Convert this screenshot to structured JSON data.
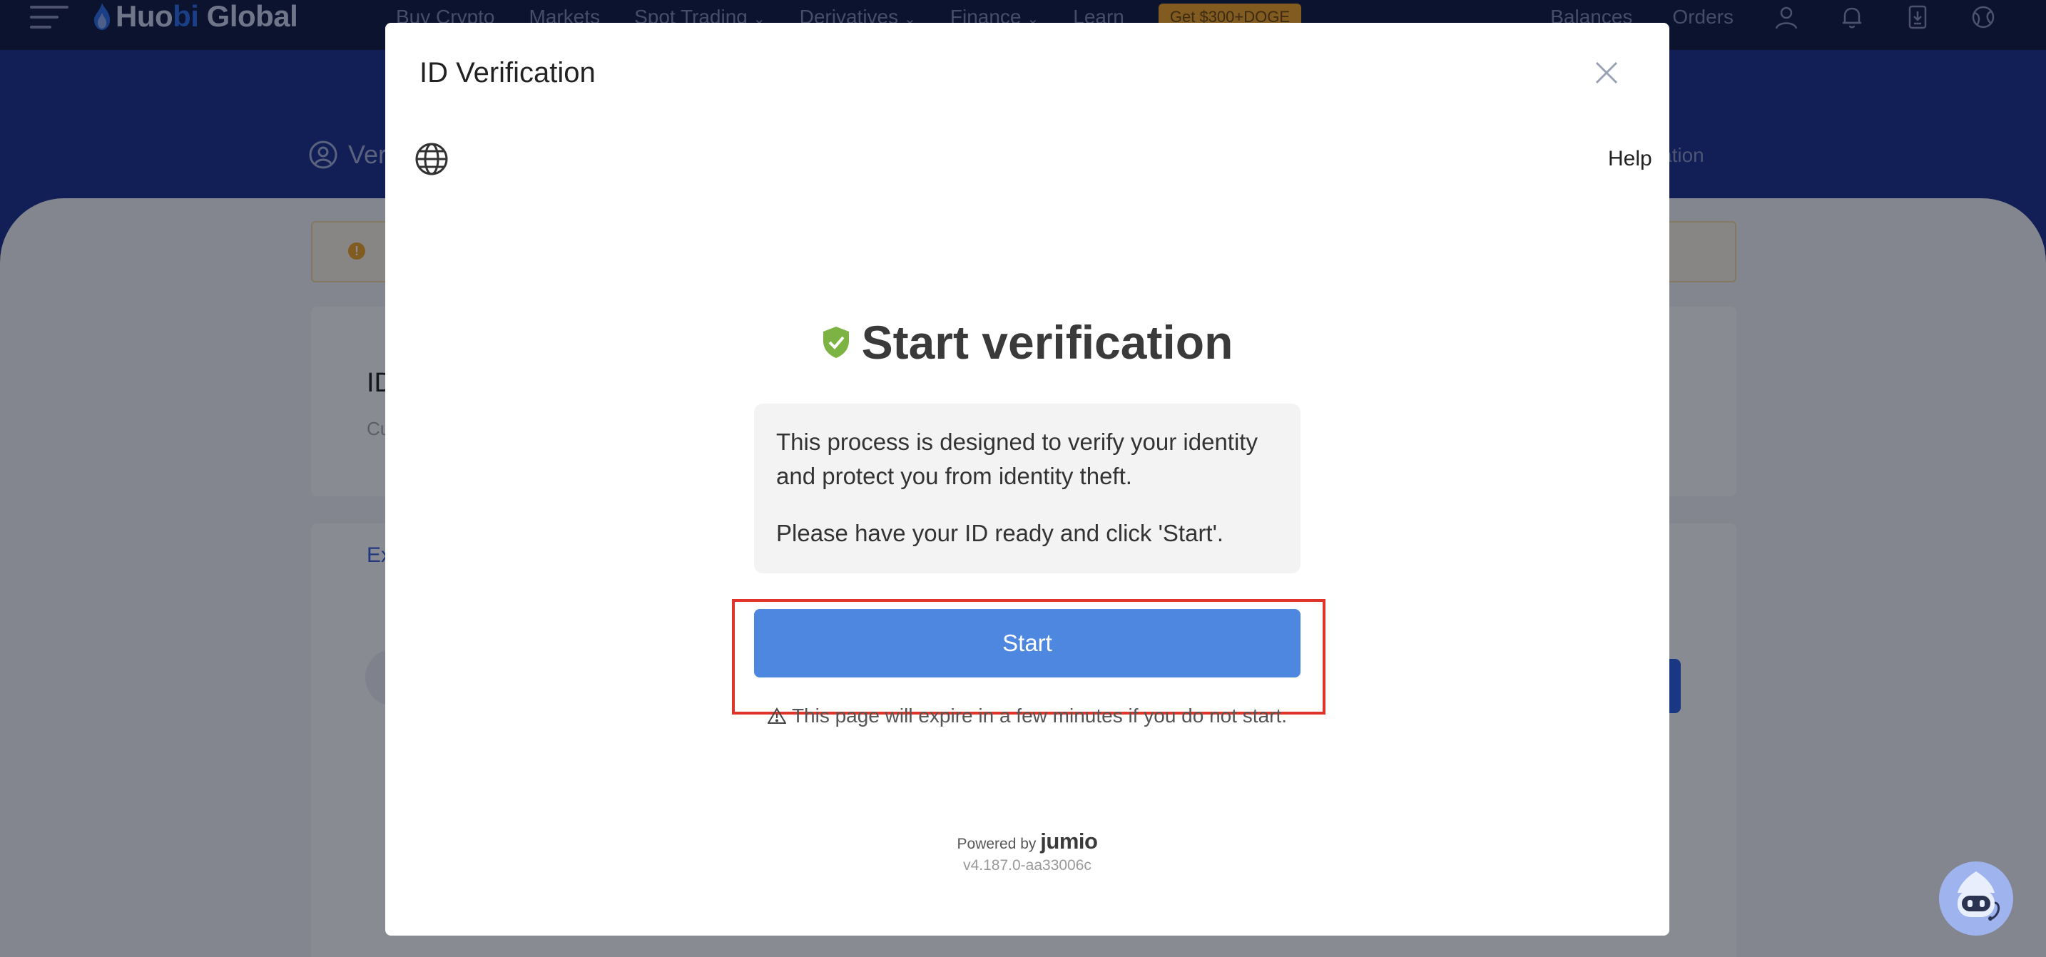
{
  "background": {
    "logo": {
      "text_main": "Huo",
      "text_accent": "bi",
      "text_tail": " Global"
    },
    "nav": {
      "items": [
        {
          "label": "Buy Crypto",
          "dropdown": false
        },
        {
          "label": "Markets",
          "dropdown": false
        },
        {
          "label": "Spot Trading",
          "dropdown": true
        },
        {
          "label": "Derivatives",
          "dropdown": true
        },
        {
          "label": "Finance",
          "dropdown": true
        },
        {
          "label": "Learn",
          "dropdown": false
        }
      ],
      "promo": "Get $300+DOGE",
      "balances": "Balances",
      "orders": "Orders"
    },
    "hero_title_partial": "Ver",
    "hero_right_partial": "fication",
    "card_title_partial": "ID",
    "card_sub_partial": "Cu",
    "card_link_partial": "Ex",
    "colors": {
      "nav_bg": "#0e1a3e",
      "hero_bg": "#1b2e8a",
      "promo": "#f0a324"
    }
  },
  "modal": {
    "title": "ID Verification",
    "help": "Help",
    "heading": "Start verification",
    "info_paragraph_1": "This process is designed to verify your identity and protect you from identity theft.",
    "info_paragraph_2": "Please have your ID ready and click 'Start'.",
    "start_button": "Start",
    "expire_notice": "This page will expire in a few minutes if you do not start.",
    "powered_by": "Powered by",
    "brand": "jumio",
    "version": "v4.187.0-aa33006c",
    "colors": {
      "start_button": "#4e87e0",
      "shield": "#7cb342",
      "highlight": "#e0332a"
    }
  }
}
